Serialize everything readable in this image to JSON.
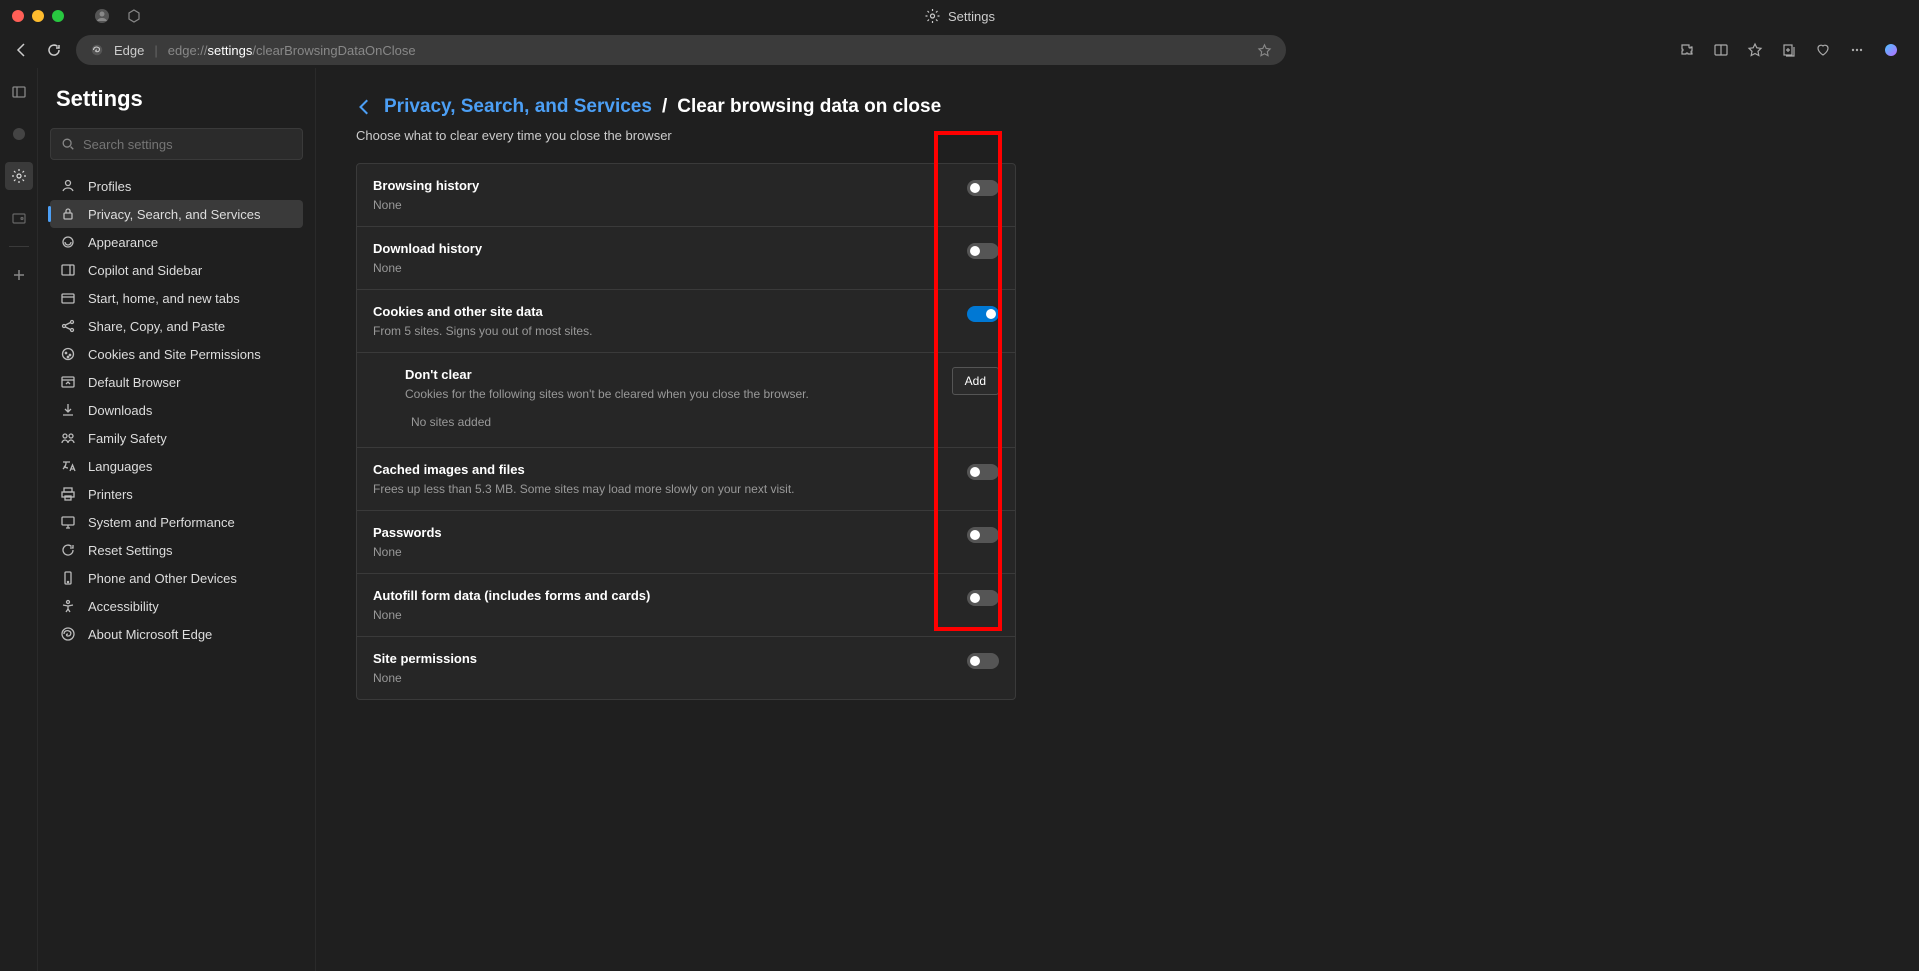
{
  "titlebar": {
    "title": "Settings"
  },
  "addressbar": {
    "product": "Edge",
    "url_prefix": "edge://",
    "url_bold": "settings",
    "url_suffix": "/clearBrowsingDataOnClose"
  },
  "sidebar": {
    "heading": "Settings",
    "search_placeholder": "Search settings",
    "items": [
      {
        "label": "Profiles",
        "icon": "profile"
      },
      {
        "label": "Privacy, Search, and Services",
        "icon": "lock",
        "selected": true
      },
      {
        "label": "Appearance",
        "icon": "appearance"
      },
      {
        "label": "Copilot and Sidebar",
        "icon": "sidebar"
      },
      {
        "label": "Start, home, and new tabs",
        "icon": "tabs"
      },
      {
        "label": "Share, Copy, and Paste",
        "icon": "share"
      },
      {
        "label": "Cookies and Site Permissions",
        "icon": "cookies"
      },
      {
        "label": "Default Browser",
        "icon": "browser"
      },
      {
        "label": "Downloads",
        "icon": "download"
      },
      {
        "label": "Family Safety",
        "icon": "family"
      },
      {
        "label": "Languages",
        "icon": "language"
      },
      {
        "label": "Printers",
        "icon": "printer"
      },
      {
        "label": "System and Performance",
        "icon": "system"
      },
      {
        "label": "Reset Settings",
        "icon": "reset"
      },
      {
        "label": "Phone and Other Devices",
        "icon": "phone"
      },
      {
        "label": "Accessibility",
        "icon": "accessibility"
      },
      {
        "label": "About Microsoft Edge",
        "icon": "edge"
      }
    ]
  },
  "main": {
    "breadcrumb_link": "Privacy, Search, and Services",
    "breadcrumb_sep": "/",
    "breadcrumb_current": "Clear browsing data on close",
    "subtitle": "Choose what to clear every time you close the browser",
    "rows": [
      {
        "title": "Browsing history",
        "desc": "None",
        "on": false
      },
      {
        "title": "Download history",
        "desc": "None",
        "on": false
      },
      {
        "title": "Cookies and other site data",
        "desc": "From 5 sites. Signs you out of most sites.",
        "on": true,
        "has_sub": true
      },
      {
        "title": "Cached images and files",
        "desc": "Frees up less than 5.3 MB. Some sites may load more slowly on your next visit.",
        "on": false
      },
      {
        "title": "Passwords",
        "desc": "None",
        "on": false
      },
      {
        "title": "Autofill form data (includes forms and cards)",
        "desc": "None",
        "on": false
      },
      {
        "title": "Site permissions",
        "desc": "None",
        "on": false
      }
    ],
    "dont_clear": {
      "title": "Don't clear",
      "desc": "Cookies for the following sites won't be cleared when you close the browser.",
      "add_label": "Add",
      "empty": "No sites added"
    }
  }
}
